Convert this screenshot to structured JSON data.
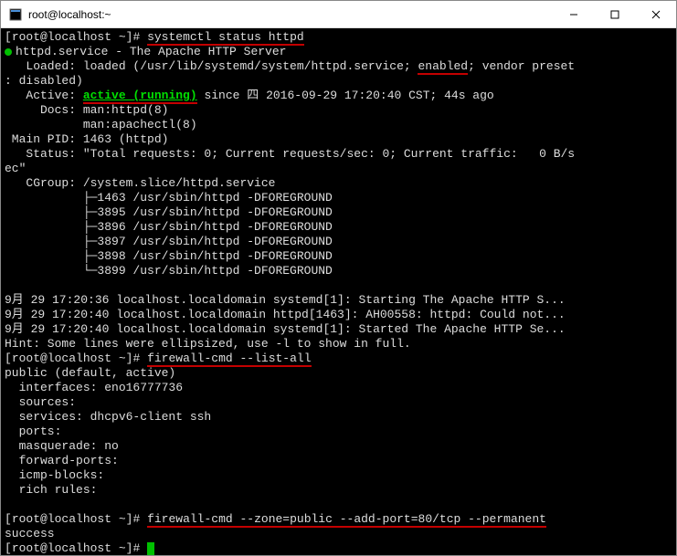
{
  "window": {
    "title": "root@localhost:~"
  },
  "prompt": {
    "user_host": "root@localhost",
    "path": "~",
    "sep_open": "[",
    "sep_close": "]#"
  },
  "cmd1": "systemctl status httpd",
  "svc": {
    "line1": "httpd.service - The Apache HTTP Server",
    "loaded_pre": "   Loaded: loaded (/usr/lib/systemd/system/httpd.service; ",
    "enabled": "enabled",
    "loaded_post": "; vendor preset",
    "disabled": ": disabled)",
    "active_pre": "   Active: ",
    "active": "active (running)",
    "active_post": " since 四 2016-09-29 17:20:40 CST; 44s ago",
    "docs1": "     Docs: man:httpd(8)",
    "docs2": "           man:apachectl(8)",
    "mainpid": " Main PID: 1463 (httpd)",
    "status": "   Status: \"Total requests: 0; Current requests/sec: 0; Current traffic:   0 B/s",
    "status2": "ec\"",
    "cgroup": "   CGroup: /system.slice/httpd.service",
    "p1": "           ├─1463 /usr/sbin/httpd -DFOREGROUND",
    "p2": "           ├─3895 /usr/sbin/httpd -DFOREGROUND",
    "p3": "           ├─3896 /usr/sbin/httpd -DFOREGROUND",
    "p4": "           ├─3897 /usr/sbin/httpd -DFOREGROUND",
    "p5": "           ├─3898 /usr/sbin/httpd -DFOREGROUND",
    "p6": "           └─3899 /usr/sbin/httpd -DFOREGROUND"
  },
  "log": {
    "l1": "9月 29 17:20:36 localhost.localdomain systemd[1]: Starting The Apache HTTP S...",
    "l2": "9月 29 17:20:40 localhost.localdomain httpd[1463]: AH00558: httpd: Could not...",
    "l3": "9月 29 17:20:40 localhost.localdomain systemd[1]: Started The Apache HTTP Se...",
    "hint": "Hint: Some lines were ellipsized, use -l to show in full."
  },
  "cmd2": "firewall-cmd --list-all",
  "fw": {
    "zone": "public (default, active)",
    "interfaces": "  interfaces: eno16777736",
    "sources": "  sources:",
    "services": "  services: dhcpv6-client ssh",
    "ports": "  ports:",
    "masq": "  masquerade: no",
    "fwdports": "  forward-ports:",
    "icmp": "  icmp-blocks:",
    "rich": "  rich rules:"
  },
  "cmd3": "firewall-cmd --zone=public --add-port=80/tcp --permanent",
  "success": "success"
}
